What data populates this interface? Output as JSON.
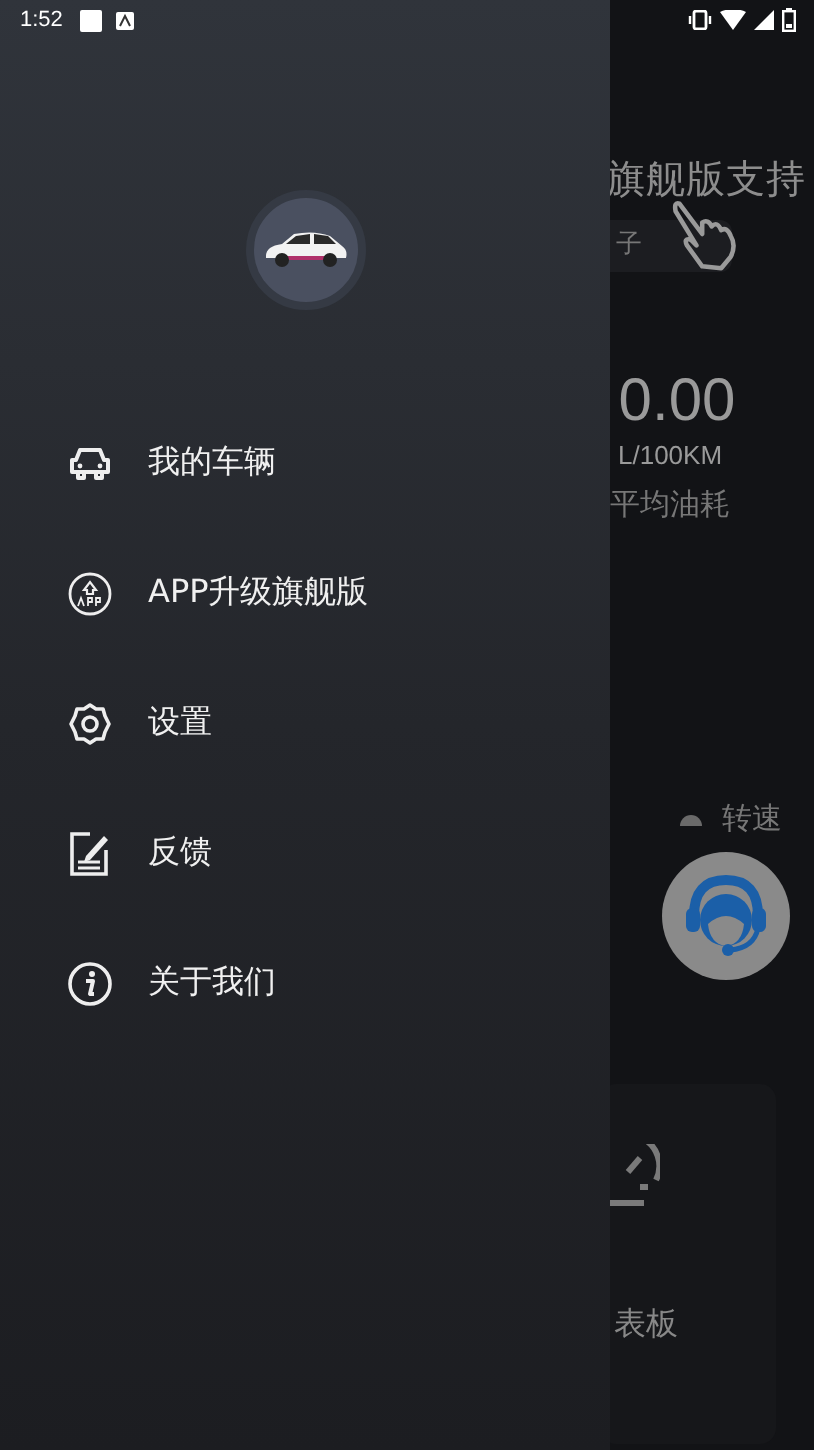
{
  "status_bar": {
    "time": "1:52"
  },
  "drawer": {
    "menu": [
      {
        "label": "我的车辆",
        "kind": "car"
      },
      {
        "label": "APP升级旗舰版",
        "kind": "upgrade"
      },
      {
        "label": "设置",
        "kind": "settings"
      },
      {
        "label": "反馈",
        "kind": "feedback"
      },
      {
        "label": "关于我们",
        "kind": "info"
      }
    ]
  },
  "background": {
    "banner": "旗舰版支持",
    "chip": "子",
    "fuel_value": "0.00",
    "fuel_unit": "L/100KM",
    "fuel_label": "平均油耗",
    "rpm_label": "转速",
    "card_label": "表板"
  }
}
